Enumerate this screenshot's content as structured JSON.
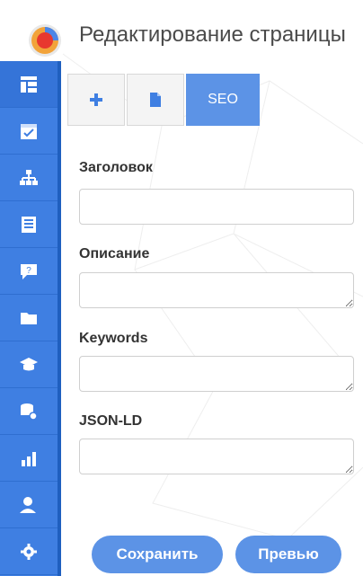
{
  "header": {
    "title": "Редактирование страницы",
    "logo_icon": "app-logo-icon"
  },
  "sidebar": {
    "items": [
      {
        "icon": "dashboard-icon"
      },
      {
        "icon": "calendar-check-icon"
      },
      {
        "icon": "sitemap-icon"
      },
      {
        "icon": "newspaper-icon"
      },
      {
        "icon": "chat-question-icon"
      },
      {
        "icon": "folder-icon"
      },
      {
        "icon": "graduation-cap-icon"
      },
      {
        "icon": "database-settings-icon"
      },
      {
        "icon": "bar-chart-icon"
      },
      {
        "icon": "user-icon"
      },
      {
        "icon": "gear-icon"
      }
    ]
  },
  "tabs": [
    {
      "icon": "plus-icon"
    },
    {
      "icon": "file-icon"
    },
    {
      "label": "SEO",
      "active": true
    }
  ],
  "form": {
    "fields": [
      {
        "label": "Заголовок",
        "value": ""
      },
      {
        "label": "Описание",
        "value": ""
      },
      {
        "label": "Keywords",
        "value": ""
      },
      {
        "label": "JSON-LD",
        "value": ""
      }
    ]
  },
  "buttons": {
    "save_label": "Сохранить",
    "preview_label": "Превью"
  },
  "colors": {
    "primary": "#3f7fe2",
    "accent": "#5c93e6"
  }
}
